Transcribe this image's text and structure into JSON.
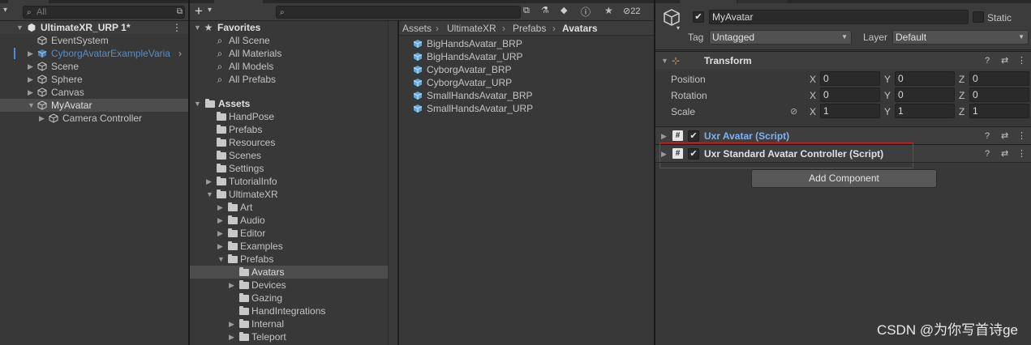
{
  "hierarchy": {
    "search_placeholder": "All",
    "scene_name": "UltimateXR_URP 1*",
    "items": [
      {
        "label": "EventSystem"
      },
      {
        "label": "CyborgAvatarExampleVaria"
      },
      {
        "label": "Scene"
      },
      {
        "label": "Sphere"
      },
      {
        "label": "Canvas"
      },
      {
        "label": "MyAvatar"
      },
      {
        "label": "Camera Controller"
      }
    ]
  },
  "project": {
    "add_label": "+",
    "hidden_count": "22",
    "favorites": {
      "label": "Favorites",
      "items": [
        "All Scene",
        "All Materials",
        "All Models",
        "All Prefabs"
      ]
    },
    "assets_label": "Assets",
    "folders": [
      "HandPose",
      "Prefabs",
      "Resources",
      "Scenes",
      "Settings",
      "TutorialInfo",
      "UltimateXR",
      "Art",
      "Audio",
      "Editor",
      "Examples",
      "Prefabs",
      "Avatars",
      "Devices",
      "Gazing",
      "HandIntegrations",
      "Internal",
      "Teleport"
    ],
    "breadcrumb": [
      "Assets",
      "UltimateXR",
      "Prefabs",
      "Avatars"
    ],
    "files": [
      "BigHandsAvatar_BRP",
      "BigHandsAvatar_URP",
      "CyborgAvatar_BRP",
      "CyborgAvatar_URP",
      "SmallHandsAvatar_BRP",
      "SmallHandsAvatar_URP"
    ]
  },
  "inspector": {
    "object_name": "MyAvatar",
    "static_label": "Static",
    "tag_label": "Tag",
    "tag_value": "Untagged",
    "layer_label": "Layer",
    "layer_value": "Default",
    "transform": {
      "title": "Transform",
      "rows": [
        {
          "label": "Position",
          "x": "0",
          "y": "0",
          "z": "0"
        },
        {
          "label": "Rotation",
          "x": "0",
          "y": "0",
          "z": "0"
        },
        {
          "label": "Scale",
          "x": "1",
          "y": "1",
          "z": "1"
        }
      ],
      "axis_x": "X",
      "axis_y": "Y",
      "axis_z": "Z"
    },
    "components": [
      {
        "title": "Uxr Avatar (Script)"
      },
      {
        "title": "Uxr Standard Avatar Controller (Script)"
      }
    ],
    "add_component_label": "Add Component",
    "highlight_color": "#d42020",
    "link_color": "#7ab4f5"
  },
  "watermark": "CSDN @为你写首诗ge"
}
